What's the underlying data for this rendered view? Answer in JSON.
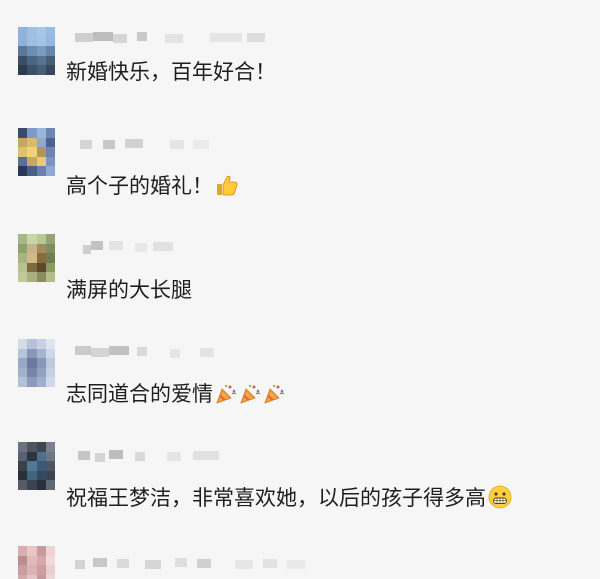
{
  "comments": [
    {
      "text": "新婚快乐，百年好合！"
    },
    {
      "text": "高个子的婚礼！"
    },
    {
      "text": "满屏的大长腿"
    },
    {
      "text": "志同道合的爱情"
    },
    {
      "text": "祝福王梦洁，非常喜欢她，以后的孩子得多高"
    },
    {
      "text": ""
    }
  ],
  "icons": {
    "thumbs_up": "thumbs-up-icon",
    "party_popper": "party-popper-icon",
    "grinning_face": "grinning-face-icon"
  },
  "colors": {
    "background": "#f6f6f6",
    "text": "#1e1e1e"
  }
}
